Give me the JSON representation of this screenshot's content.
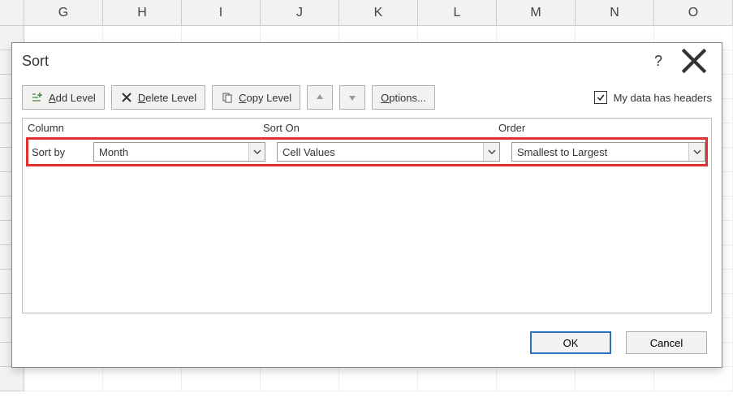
{
  "columns": [
    "G",
    "H",
    "I",
    "J",
    "K",
    "L",
    "M",
    "N",
    "O"
  ],
  "dialog": {
    "title": "Sort",
    "toolbar": {
      "add_label": "Add Level",
      "delete_label": "Delete Level",
      "copy_label": "Copy Level",
      "options_label": "Options...",
      "headers_label": "My data has headers",
      "headers_checked": true
    },
    "grid": {
      "col_column": "Column",
      "col_sort_on": "Sort On",
      "col_order": "Order",
      "row1": {
        "label": "Sort by",
        "column": "Month",
        "sort_on": "Cell Values",
        "order": "Smallest to Largest"
      }
    },
    "footer": {
      "ok": "OK",
      "cancel": "Cancel"
    }
  },
  "highlight_color": "#e03030"
}
